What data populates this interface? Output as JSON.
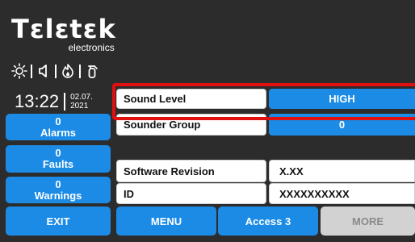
{
  "brand": {
    "name": "Tɛlɛtɛk",
    "sub": "electronics"
  },
  "status_icons": [
    "sun-brightness-icon",
    "speaker-icon",
    "fire-flame-icon",
    "fire-extinguisher-icon"
  ],
  "clock": {
    "time": "13:22",
    "date_day": "02.07.",
    "date_year": "2021"
  },
  "sidebar": {
    "alarms": {
      "count": "0",
      "label": "Alarms"
    },
    "faults": {
      "count": "0",
      "label": "Faults"
    },
    "warnings": {
      "count": "0",
      "label": "Warnings"
    },
    "exit_label": "EXIT"
  },
  "settings": {
    "sound_level": {
      "label": "Sound Level",
      "value": "HIGH"
    },
    "sounder_group": {
      "label": "Sounder Group",
      "value": "0"
    },
    "software_revision": {
      "label": "Software Revision",
      "value": "X.XX"
    },
    "id": {
      "label": "ID",
      "value": "XXXXXXXXXX"
    }
  },
  "bottom": {
    "menu_label": "MENU",
    "access_label": "Access 3",
    "more_label": "MORE"
  },
  "colors": {
    "background": "#2c2c2c",
    "accent_blue": "#1b8be6",
    "highlight_red": "#e01010",
    "disabled_gray": "#d2d2d2"
  }
}
